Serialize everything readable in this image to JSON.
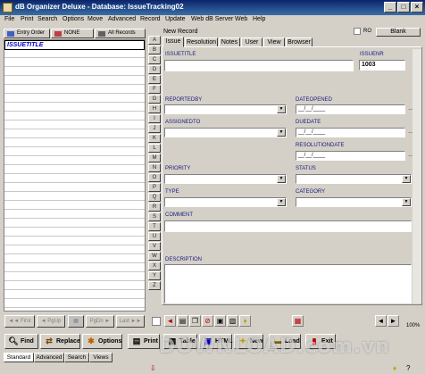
{
  "window": {
    "title": "dB Organizer Deluxe - Database: IssueTracking02"
  },
  "menu": [
    "File",
    "Print",
    "Search",
    "Options",
    "Move",
    "Advanced",
    "Record",
    "Update",
    "Web dB Server",
    "Web",
    "Help"
  ],
  "left_tabs": {
    "entry_order": "Entry Order",
    "none": "NONE",
    "all_records": "All Records"
  },
  "list_header": "ISSUETITLE",
  "nav": {
    "first": "First",
    "pgup": "PgUp",
    "pgdn": "PgDn",
    "last": "Last"
  },
  "letters": [
    "A",
    "B",
    "C",
    "D",
    "E",
    "F",
    "G",
    "H",
    "I",
    "J",
    "K",
    "L",
    "M",
    "N",
    "O",
    "P",
    "Q",
    "R",
    "S",
    "T",
    "U",
    "V",
    "W",
    "X",
    "Y",
    "Z"
  ],
  "record": {
    "status": "New Record",
    "ro_label": "RO",
    "blank_label": "Blank"
  },
  "tabs": [
    "Issue",
    "Resolution",
    "Notes",
    "User",
    "View",
    "Browser"
  ],
  "form": {
    "issuetitle_label": "ISSUETITLE",
    "issuenr_label": "ISSUENR",
    "issuenr_value": "1003",
    "reportedby_label": "REPORTEDBY",
    "dateopened_label": "DATEOPENED",
    "dateopened_value": "__/__/____",
    "assignedto_label": "ASSIGNEDTO",
    "duedate_label": "DUEDATE",
    "duedate_value": "__/__/____",
    "resolutiondate_label": "RESOLUTIONDATE",
    "resolutiondate_value": "__/__/____",
    "priority_label": "PRIORITY",
    "status_label": "STATUS",
    "type_label": "TYPE",
    "category_label": "CATEGORY",
    "comment_label": "COMMENT",
    "description_label": "DESCRIPTION"
  },
  "zoom": "100%",
  "buttons": {
    "find": "Find",
    "replace": "Replace",
    "options": "Options",
    "print": "Print",
    "table": "Table",
    "html": "HTML",
    "new": "New",
    "load": "Load",
    "exit": "Exit"
  },
  "bottom_tabs": [
    "Standard",
    "Advanced",
    "Search",
    "Views"
  ],
  "watermark": "DOWNLOAD.com.vn"
}
